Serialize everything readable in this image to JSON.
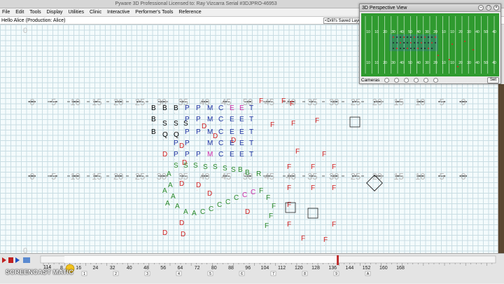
{
  "titlebar": {
    "title": "Pyware 3D Professional     Licensed to: Ray Vizcarra     Serial #3DJPRO-46953"
  },
  "menu": [
    "File",
    "Edit",
    "Tools",
    "Display",
    "Utilities",
    "Clinic",
    "Interactive",
    "Performer's Tools",
    "Reference"
  ],
  "info": {
    "greeting": "Hello Alice    (Production:  Alice)",
    "saved_layouts": "<Drill's Saved Layouts>"
  },
  "yard_numbers": [
    "0",
    "5",
    "10",
    "15",
    "20",
    "25",
    "30",
    "35",
    "40",
    "45",
    "50",
    "45",
    "40",
    "35",
    "30",
    "25",
    "20",
    "15",
    "10",
    "5",
    "0"
  ],
  "sideline_zero": "0",
  "perspective": {
    "title": "3D Perspective View",
    "yard_numbers": [
      "10",
      "10",
      "20",
      "30",
      "40",
      "50",
      "40",
      "30",
      "20",
      "10",
      "10",
      "20",
      "30",
      "40",
      "50",
      "40"
    ],
    "cameras_label": "Cameras",
    "set_label": "Set"
  },
  "timeline": {
    "current": "114",
    "ticks": [
      "8",
      "16",
      "24",
      "32",
      "40",
      "48",
      "56",
      "64",
      "72",
      "80",
      "88",
      "96",
      "104",
      "112",
      "120",
      "128",
      "136",
      "144",
      "152",
      "160",
      "168"
    ],
    "set_markers": [
      "1",
      "2",
      "3",
      "4",
      "5",
      "6",
      "7",
      "8",
      "9",
      "A"
    ]
  },
  "watermark": "SCREENCAST  MATIC",
  "colors": {
    "field_bg": "#f4fbfc",
    "grid": "#c9dde3",
    "winds": "#d12020",
    "brass": "#1a2fa0",
    "guard": "#2a8a2a",
    "perc": "#000000",
    "mallet": "#cc2aa8"
  }
}
